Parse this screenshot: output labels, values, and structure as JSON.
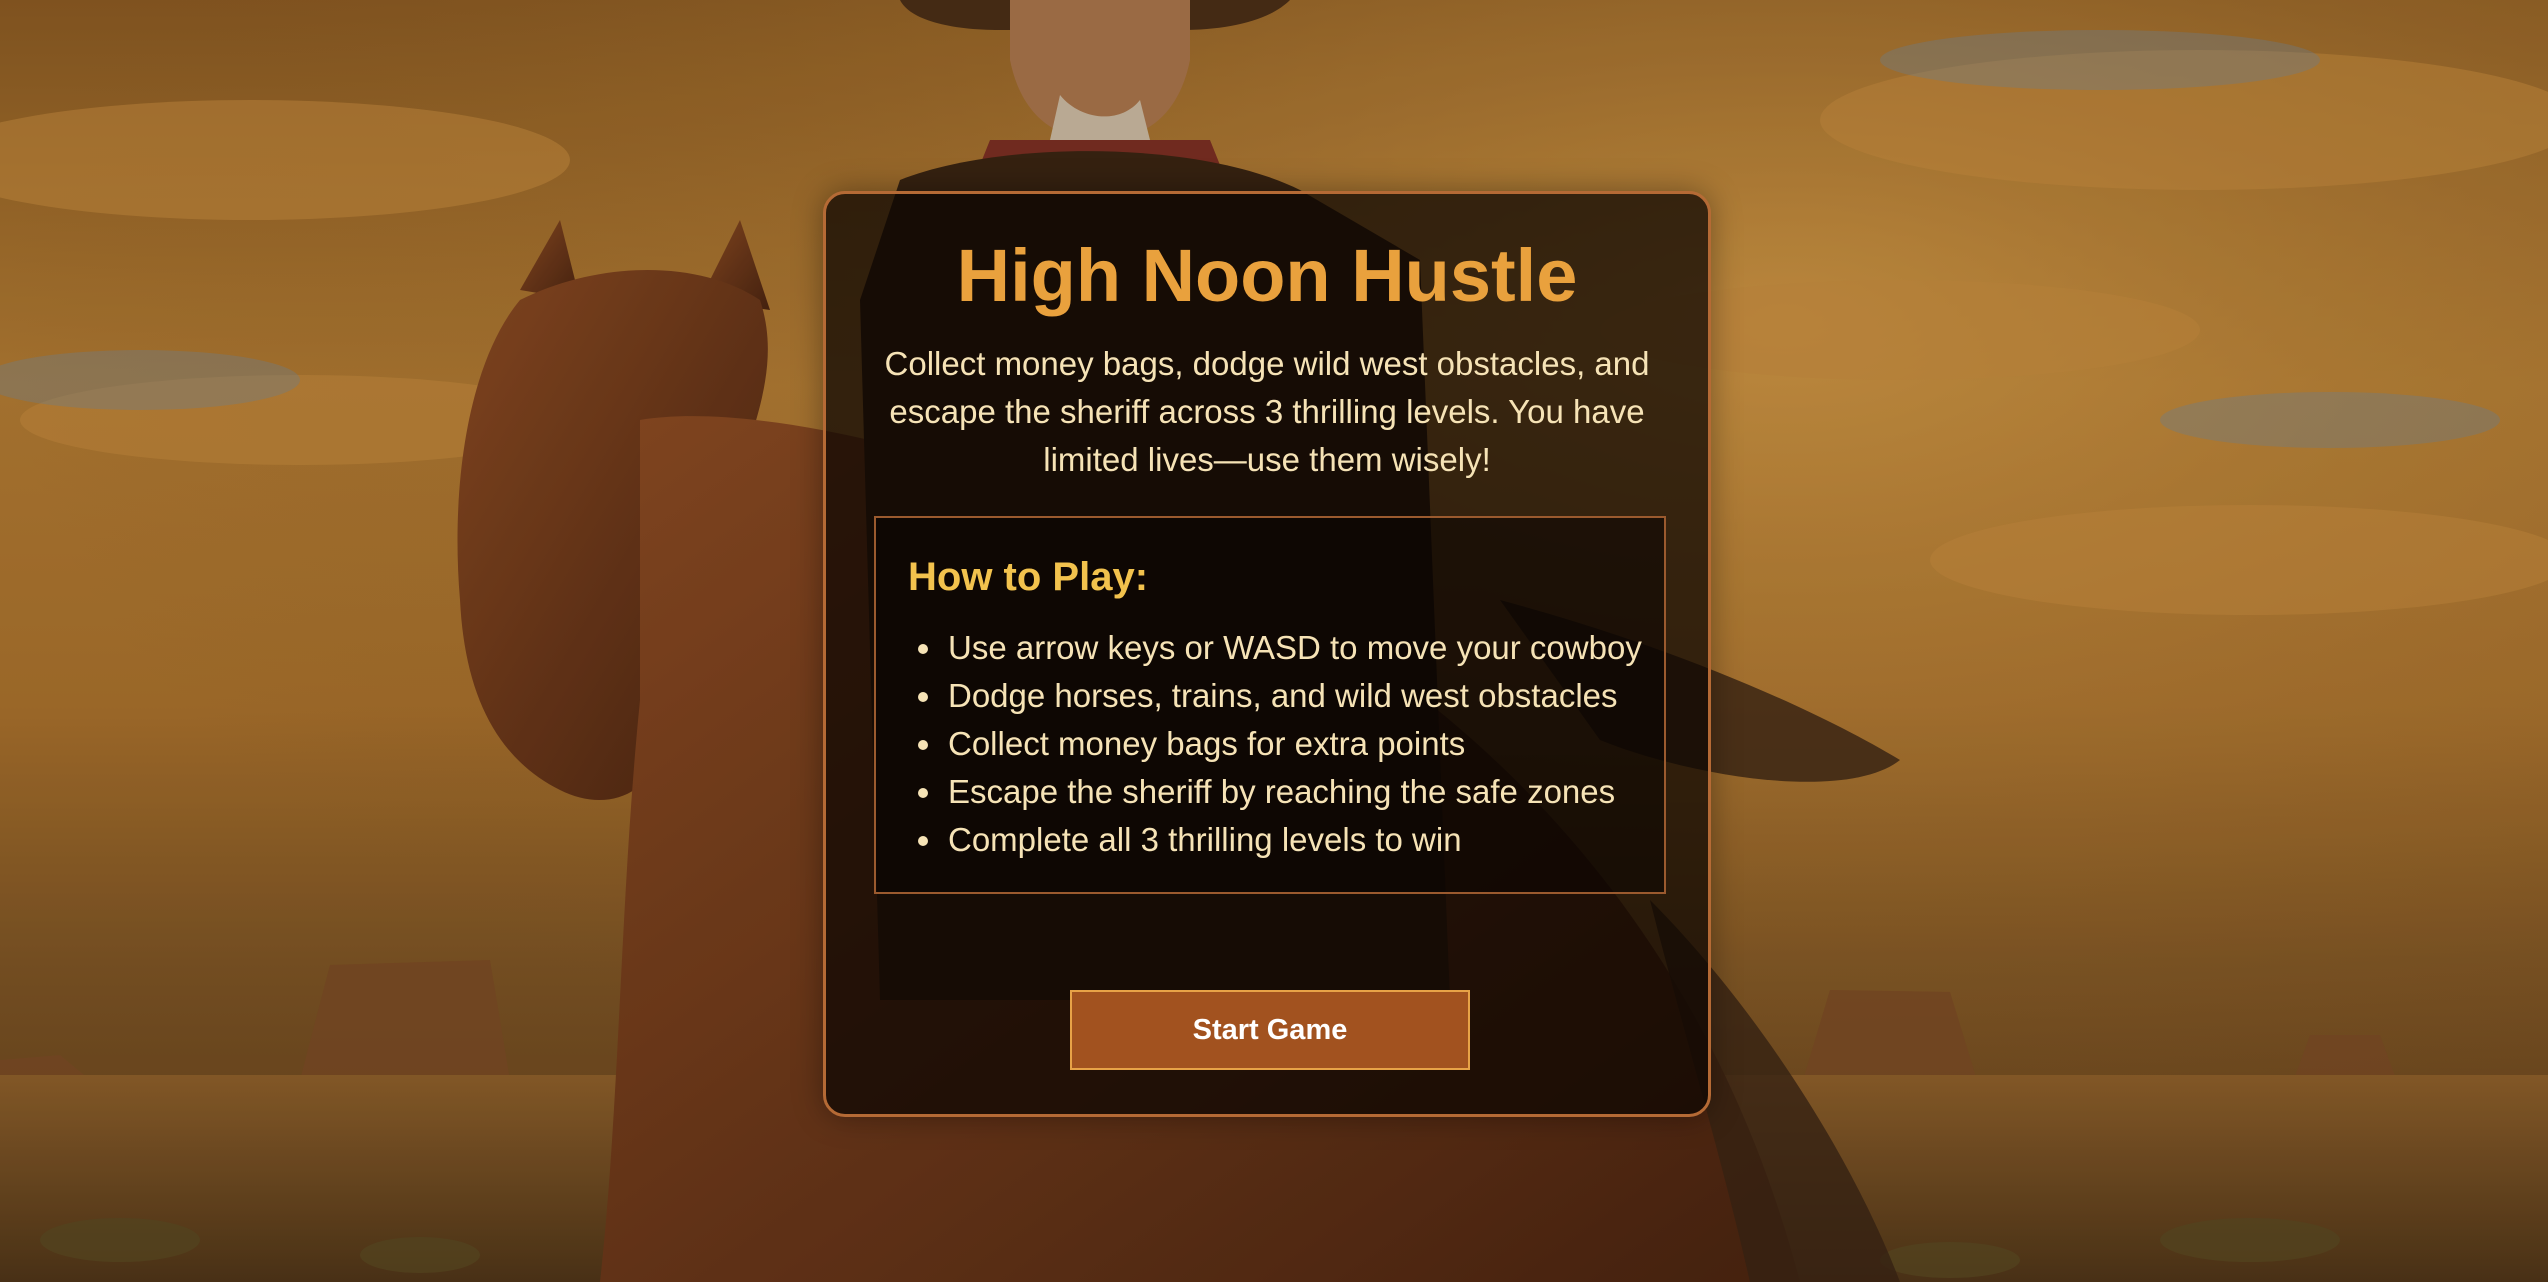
{
  "game": {
    "title": "High Noon Hustle",
    "description": "Collect money bags, dodge wild west obstacles, and escape the sheriff across 3 thrilling levels. You have limited lives—use them wisely!"
  },
  "how_to_play": {
    "heading": "How to Play:",
    "items": [
      "Use arrow keys or WASD to move your cowboy",
      "Dodge horses, trains, and wild west obstacles",
      "Collect money bags for extra points",
      "Escape the sheriff by reaching the safe zones",
      "Complete all 3 thrilling levels to win"
    ]
  },
  "start_button": {
    "label": "Start Game"
  },
  "colors": {
    "title": "#e9a13d",
    "heading": "#f2c24d",
    "text": "#f6e3b6",
    "panel_border": "#b56a35",
    "button_bg": "#a2521f",
    "button_border": "#e7a247"
  },
  "background": {
    "scene": "cowboy-on-horse-desert-sunset"
  }
}
